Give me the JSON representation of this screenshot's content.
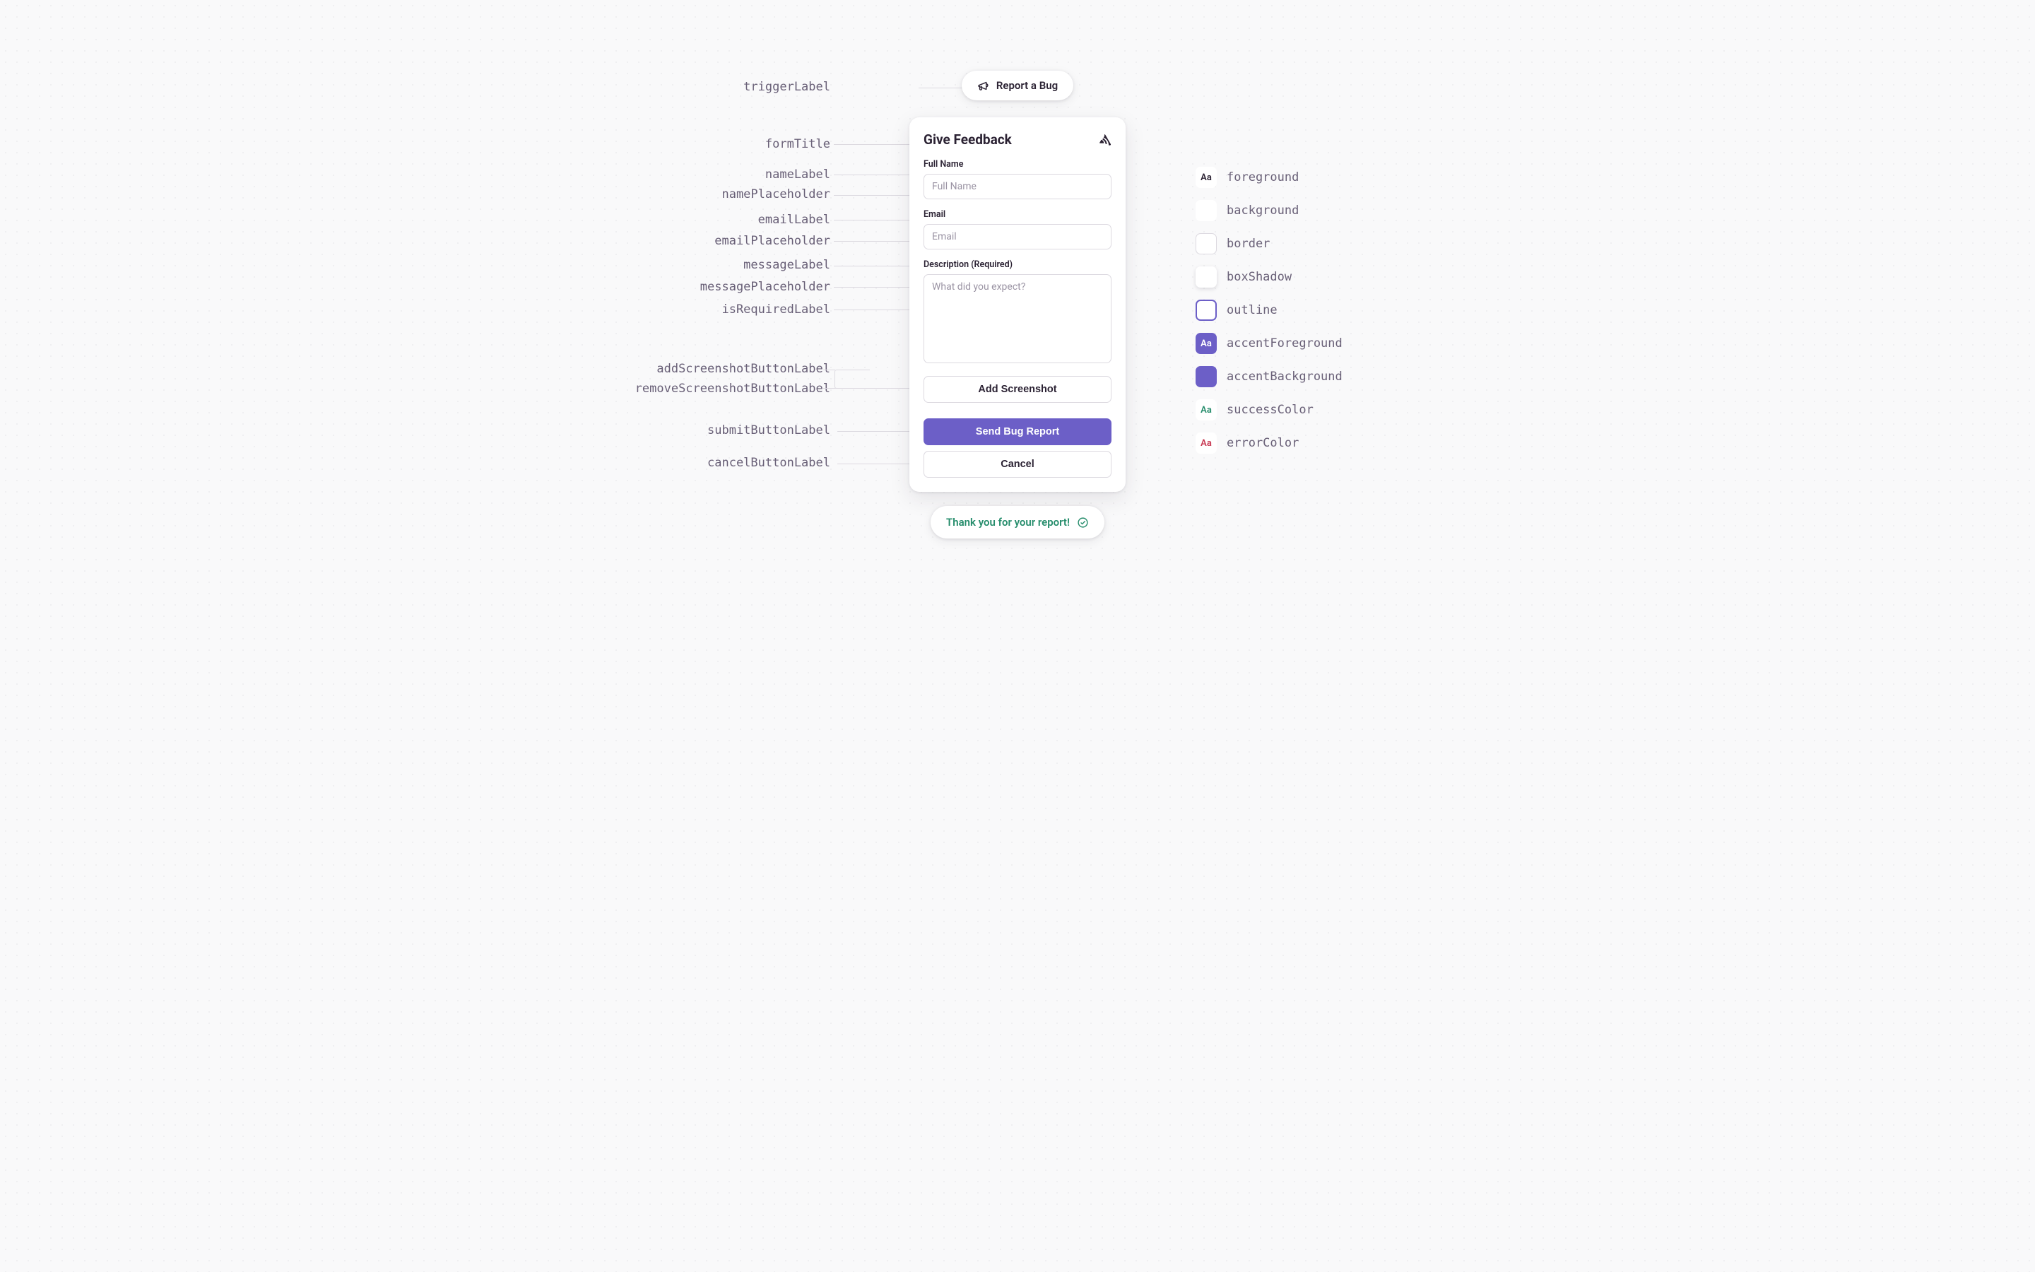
{
  "trigger": {
    "label": "Report a Bug"
  },
  "form": {
    "title": "Give Feedback",
    "name_label": "Full Name",
    "name_placeholder": "Full Name",
    "email_label": "Email",
    "email_placeholder": "Email",
    "message_label": "Description (Required)",
    "message_placeholder": "What did you expect?",
    "add_screenshot_label": "Add Screenshot",
    "submit_label": "Send Bug Report",
    "cancel_label": "Cancel"
  },
  "success": {
    "message": "Thank you for your report!"
  },
  "annotations": {
    "triggerLabel": "triggerLabel",
    "formTitle": "formTitle",
    "nameLabel": "nameLabel",
    "namePlaceholder": "namePlaceholder",
    "emailLabel": "emailLabel",
    "emailPlaceholder": "emailPlaceholder",
    "messageLabel": "messageLabel",
    "messagePlaceholder": "messagePlaceholder",
    "isRequiredLabel": "isRequiredLabel",
    "addScreenshotButtonLabel": "addScreenshotButtonLabel",
    "removeScreenshotButtonLabel": "removeScreenshotButtonLabel",
    "submitButtonLabel": "submitButtonLabel",
    "cancelButtonLabel": "cancelButtonLabel"
  },
  "legend": {
    "sample": "Aa",
    "items": [
      {
        "key": "foreground",
        "label": "foreground"
      },
      {
        "key": "background",
        "label": "background"
      },
      {
        "key": "border",
        "label": "border"
      },
      {
        "key": "boxShadow",
        "label": "boxShadow"
      },
      {
        "key": "outline",
        "label": "outline"
      },
      {
        "key": "accentForeground",
        "label": "accentForeground"
      },
      {
        "key": "accentBackground",
        "label": "accentBackground"
      },
      {
        "key": "successColor",
        "label": "successColor"
      },
      {
        "key": "errorColor",
        "label": "errorColor"
      }
    ]
  },
  "colors": {
    "foreground": "#2b2233",
    "background": "#ffffff",
    "border": "#dcd9e0",
    "outline": "#6c5fc7",
    "accentBackground": "#6c5fc7",
    "accentForeground": "#ffffff",
    "successColor": "#268d6c",
    "errorColor": "#c83852"
  }
}
